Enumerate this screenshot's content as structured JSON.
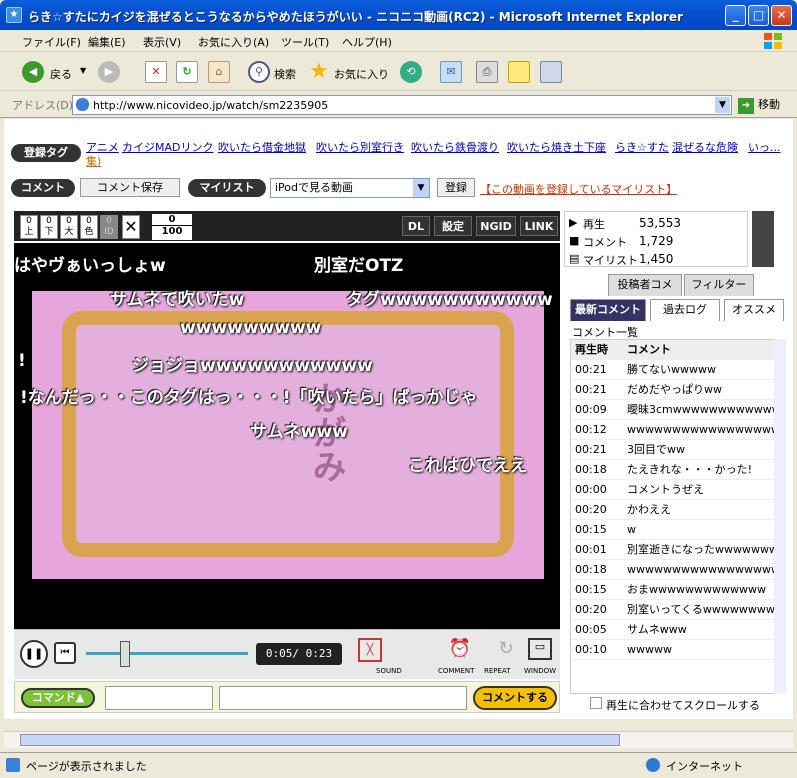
{
  "window": {
    "title": "らき☆すたにカイジを混ぜるとこうなるからやめたほうがいい - ニコニコ動画(RC2) - Microsoft Internet Explorer"
  },
  "menu": [
    "ファイル(F)",
    "編集(E)",
    "表示(V)",
    "お気に入り(A)",
    "ツール(T)",
    "ヘルプ(H)"
  ],
  "toolbar": {
    "back": "戻る",
    "search": "検索",
    "favorites": "お気に入り"
  },
  "address": {
    "label": "アドレス(D)",
    "url": "http://www.nicovideo.jp/watch/sm2235905",
    "go": "移動"
  },
  "tags": {
    "label": "登録タグ",
    "items": [
      "アニメ",
      "カイジMADリンク",
      "吹いたら借金地獄",
      "吹いたら別室行き",
      "吹いたら鉄骨渡り",
      "吹いたら焼き土下座",
      "らき☆すた",
      "混ぜるな危険",
      "いっ..."
    ],
    "tail": "集)"
  },
  "actions": {
    "comment": "コメント",
    "save_comment": "コメント保存",
    "mylist": "マイリスト",
    "mylist_select": "iPodで見る動画",
    "register": "登録",
    "mylist_link": "【この動画を登録しているマイリスト】"
  },
  "player": {
    "buttons": [
      "0\n上",
      "0\n下",
      "0\n大",
      "0\n色",
      "0\nID"
    ],
    "fraction_num": "0",
    "fraction_den": "100",
    "right_buttons": [
      "DL",
      "設定",
      "NGID",
      "LINK"
    ],
    "time": "0:05/ 0:23",
    "labels": [
      "SOUND",
      "COMMENT",
      "REPEAT",
      "WINDOW"
    ],
    "comment_cmd": "コマンド▲",
    "comment_submit": "コメントする"
  },
  "video": {
    "overlay_text": "かがみ",
    "comments": [
      "はやヴぁいっしょw",
      "別室だOTZ",
      "サムネで吹いたw",
      "タグwwwwwwwwwww",
      "wwwwwwwww",
      "ジョジョwwwwwwwwwww",
      "!",
      "!なんだっ・・このタグはっ・・・!「吹いたら」ばっかじゃ",
      "サムネwww",
      "これはひでええ"
    ]
  },
  "stats": {
    "play_label": "再生",
    "play": "53,553",
    "comment_label": "コメント",
    "comment": "1,729",
    "mylist_label": "マイリスト",
    "mylist": "1,450"
  },
  "tabs": {
    "top": [
      "投稿者コメ",
      "フィルター"
    ],
    "bottom": [
      "最新コメント",
      "過去ログ",
      "オススメ"
    ]
  },
  "comment_list": {
    "title": "コメント一覧",
    "col_time": "再生時",
    "col_comment": "コメント",
    "rows": [
      [
        "00:21",
        "勝てないwwwww"
      ],
      [
        "00:21",
        "だめだやっぱりww"
      ],
      [
        "00:09",
        "曖昧3cmwwwwwwwwwwwwwww"
      ],
      [
        "00:12",
        "wwwwwwwwwwwwwwwwwwwwwww"
      ],
      [
        "00:21",
        "3回目でww"
      ],
      [
        "00:18",
        "たえきれな・・・かった!"
      ],
      [
        "00:00",
        "コメントうぜえ"
      ],
      [
        "00:20",
        "かわええ"
      ],
      [
        "00:15",
        "w"
      ],
      [
        "00:01",
        "別室逝きになったwwwwwwww"
      ],
      [
        "00:18",
        "wwwwwwwwwwwwwwwwwwwww"
      ],
      [
        "00:15",
        "おまwwwwwwwwwwwww"
      ],
      [
        "00:20",
        "別室いってくるwwwwwwww"
      ],
      [
        "00:05",
        "サムネwww"
      ],
      [
        "00:10",
        "wwwww"
      ]
    ],
    "scroll_checkbox": "再生に合わせてスクロールする"
  },
  "status": {
    "text": "ページが表示されました",
    "zone": "インターネット"
  }
}
